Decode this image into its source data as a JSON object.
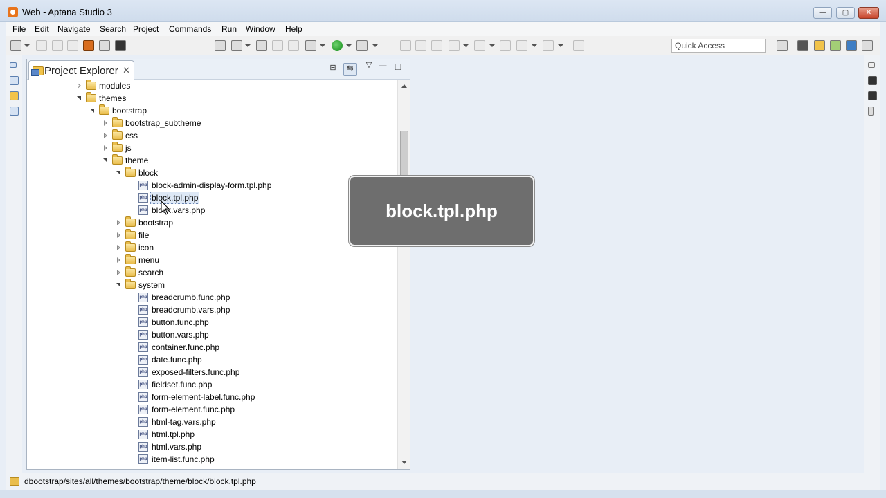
{
  "window": {
    "title": "Web - Aptana Studio 3",
    "minimize_glyph": "—",
    "maximize_glyph": "▢",
    "close_glyph": "✕"
  },
  "menu": [
    "File",
    "Edit",
    "Navigate",
    "Search",
    "Project",
    "Commands",
    "Run",
    "Window",
    "Help"
  ],
  "toolbar": {
    "quick_access_placeholder": "Quick Access"
  },
  "explorer": {
    "tab_label": "Project Explorer",
    "close_glyph": "✕",
    "minimize_glyph": "—",
    "maximize_glyph": "□",
    "view_menu_glyph": "▽"
  },
  "tree": [
    {
      "label": "modules",
      "type": "folder",
      "depth": 0,
      "state": "closed"
    },
    {
      "label": "themes",
      "type": "folder",
      "depth": 0,
      "state": "open"
    },
    {
      "label": "bootstrap",
      "type": "folder",
      "depth": 1,
      "state": "open"
    },
    {
      "label": "bootstrap_subtheme",
      "type": "folder",
      "depth": 2,
      "state": "closed"
    },
    {
      "label": "css",
      "type": "folder",
      "depth": 2,
      "state": "closed"
    },
    {
      "label": "js",
      "type": "folder",
      "depth": 2,
      "state": "closed"
    },
    {
      "label": "theme",
      "type": "folder",
      "depth": 2,
      "state": "open"
    },
    {
      "label": "block",
      "type": "folder",
      "depth": 3,
      "state": "open"
    },
    {
      "label": "block-admin-display-form.tpl.php",
      "type": "php",
      "depth": 4
    },
    {
      "label": "block.tpl.php",
      "type": "php",
      "depth": 4,
      "selected": true
    },
    {
      "label": "block.vars.php",
      "type": "php",
      "depth": 4
    },
    {
      "label": "bootstrap",
      "type": "folder",
      "depth": 3,
      "state": "closed"
    },
    {
      "label": "file",
      "type": "folder",
      "depth": 3,
      "state": "closed"
    },
    {
      "label": "icon",
      "type": "folder",
      "depth": 3,
      "state": "closed"
    },
    {
      "label": "menu",
      "type": "folder",
      "depth": 3,
      "state": "closed"
    },
    {
      "label": "search",
      "type": "folder",
      "depth": 3,
      "state": "closed"
    },
    {
      "label": "system",
      "type": "folder",
      "depth": 3,
      "state": "open"
    },
    {
      "label": "breadcrumb.func.php",
      "type": "php",
      "depth": 4
    },
    {
      "label": "breadcrumb.vars.php",
      "type": "php",
      "depth": 4
    },
    {
      "label": "button.func.php",
      "type": "php",
      "depth": 4
    },
    {
      "label": "button.vars.php",
      "type": "php",
      "depth": 4
    },
    {
      "label": "container.func.php",
      "type": "php",
      "depth": 4
    },
    {
      "label": "date.func.php",
      "type": "php",
      "depth": 4
    },
    {
      "label": "exposed-filters.func.php",
      "type": "php",
      "depth": 4
    },
    {
      "label": "fieldset.func.php",
      "type": "php",
      "depth": 4
    },
    {
      "label": "form-element-label.func.php",
      "type": "php",
      "depth": 4
    },
    {
      "label": "form-element.func.php",
      "type": "php",
      "depth": 4
    },
    {
      "label": "html-tag.vars.php",
      "type": "php",
      "depth": 4
    },
    {
      "label": "html.tpl.php",
      "type": "php",
      "depth": 4
    },
    {
      "label": "html.vars.php",
      "type": "php",
      "depth": 4
    },
    {
      "label": "item-list.func.php",
      "type": "php",
      "depth": 4
    }
  ],
  "php_icon_text": "php",
  "overlay": {
    "text": "block.tpl.php"
  },
  "status": {
    "path": "dbootstrap/sites/all/themes/bootstrap/theme/block/block.tpl.php"
  }
}
